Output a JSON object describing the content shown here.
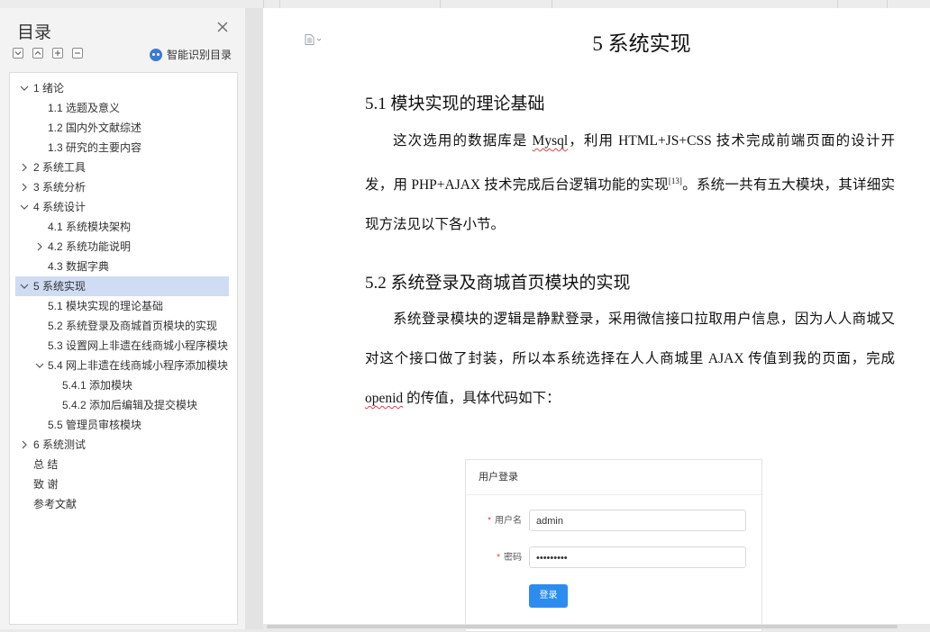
{
  "sidebar": {
    "title": "目录",
    "smart_toc_label": "智能识别目录",
    "items": [
      {
        "label": "1  绪论",
        "level": 0,
        "expander": "down"
      },
      {
        "label": "1.1  选题及意义",
        "level": 1,
        "expander": "none"
      },
      {
        "label": "1.2  国内外文献综述",
        "level": 1,
        "expander": "none"
      },
      {
        "label": "1.3  研究的主要内容",
        "level": 1,
        "expander": "none"
      },
      {
        "label": "2  系统工具",
        "level": 0,
        "expander": "right"
      },
      {
        "label": "3  系统分析",
        "level": 0,
        "expander": "right"
      },
      {
        "label": "4  系统设计",
        "level": 0,
        "expander": "down"
      },
      {
        "label": "4.1 系统模块架构",
        "level": 1,
        "expander": "none"
      },
      {
        "label": "4.2 系统功能说明",
        "level": 1,
        "expander": "right"
      },
      {
        "label": "4.3  数据字典",
        "level": 1,
        "expander": "none"
      },
      {
        "label": "5  系统实现",
        "level": 0,
        "expander": "down",
        "active": true
      },
      {
        "label": "5.1  模块实现的理论基础",
        "level": 1,
        "expander": "none"
      },
      {
        "label": "5.2  系统登录及商城首页模块的实现",
        "level": 1,
        "expander": "none"
      },
      {
        "label": "5.3  设置网上非遗在线商城小程序模块",
        "level": 1,
        "expander": "none"
      },
      {
        "label": "5.4  网上非遗在线商城小程序添加模块",
        "level": 1,
        "expander": "down"
      },
      {
        "label": "5.4.1  添加模块",
        "level": 2,
        "expander": "none"
      },
      {
        "label": "5.4.2  添加后编辑及提交模块",
        "level": 2,
        "expander": "none"
      },
      {
        "label": "5.5  管理员审核模块",
        "level": 1,
        "expander": "none"
      },
      {
        "label": "6  系统测试",
        "level": 0,
        "expander": "right"
      },
      {
        "label": "总    结",
        "level": 0,
        "expander": "none"
      },
      {
        "label": "致    谢",
        "level": 0,
        "expander": "none"
      },
      {
        "label": "参考文献",
        "level": 0,
        "expander": "none"
      }
    ]
  },
  "document": {
    "chapter_title": "5  系统实现",
    "sec1_title": "5.1  模块实现的理论基础",
    "sec1_p_a": "这次选用的数据库是 ",
    "sec1_p_mysql": "Mysql",
    "sec1_p_b": "，利用 HTML+JS+CSS 技术完成前端页面的设计开发，用 PHP+AJAX 技术完成后台逻辑功能的实现",
    "sec1_p_cite": "[13]",
    "sec1_p_c": "。系统一共有五大模块，其详细实现方法见以下各小节。",
    "sec2_title": "5.2  系统登录及商城首页模块的实现",
    "sec2_p_a": "系统登录模块的逻辑是静默登录，采用微信接口拉取用户信息，因为人人商城又对这个接口做了封装，所以本系统选择在人人商城里 AJAX 传值到我的页面，完成 ",
    "sec2_p_openid": "openid",
    "sec2_p_b": " 的传值，具体代码如下："
  },
  "login_figure": {
    "header": "用户登录",
    "required_mark": "*",
    "username_label": "用户名",
    "username_value": "admin",
    "password_label": "密码",
    "password_value": "•••••••••",
    "submit_label": "登录"
  },
  "colors": {
    "active_row": "#cfdcf3",
    "login_button": "#2d8cf0",
    "required": "#e0443b"
  }
}
